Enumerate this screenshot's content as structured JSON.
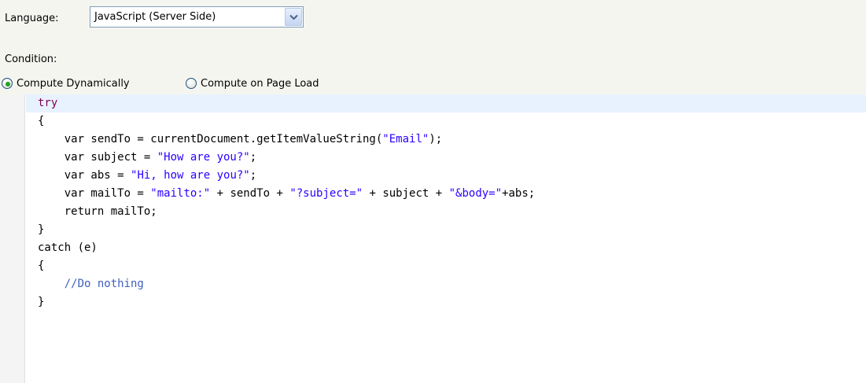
{
  "language": {
    "label": "Language:",
    "selected": "JavaScript (Server Side)"
  },
  "condition": {
    "label": "Condition:",
    "options": [
      {
        "label": "Compute Dynamically",
        "selected": true
      },
      {
        "label": "Compute on Page Load",
        "selected": false
      }
    ]
  },
  "code": {
    "lines": [
      [
        "try"
      ],
      [
        "{"
      ],
      [
        "    var sendTo = currentDocument.getItemValueString(",
        "\"Email\"",
        ");"
      ],
      [
        "    var subject = ",
        "\"How are you?\"",
        ";"
      ],
      [
        "    var abs = ",
        "\"Hi, how are you?\"",
        ";"
      ],
      [
        "    var mailTo = ",
        "\"mailto:\"",
        " + sendTo + ",
        "\"?subject=\"",
        " + subject + ",
        "\"&body=\"",
        "+abs;"
      ],
      [
        "    return mailTo;"
      ],
      [
        "}"
      ],
      [
        "catch (e)"
      ],
      [
        "{"
      ],
      [
        "    //Do nothing"
      ],
      [
        "}"
      ]
    ]
  },
  "colors": {
    "keyword": "#7f0055",
    "string": "#2a00ff",
    "comment": "#3f5fbf",
    "current_line": "#e8f2fe"
  },
  "icons": {
    "dropdown": "chevron-down-icon"
  }
}
